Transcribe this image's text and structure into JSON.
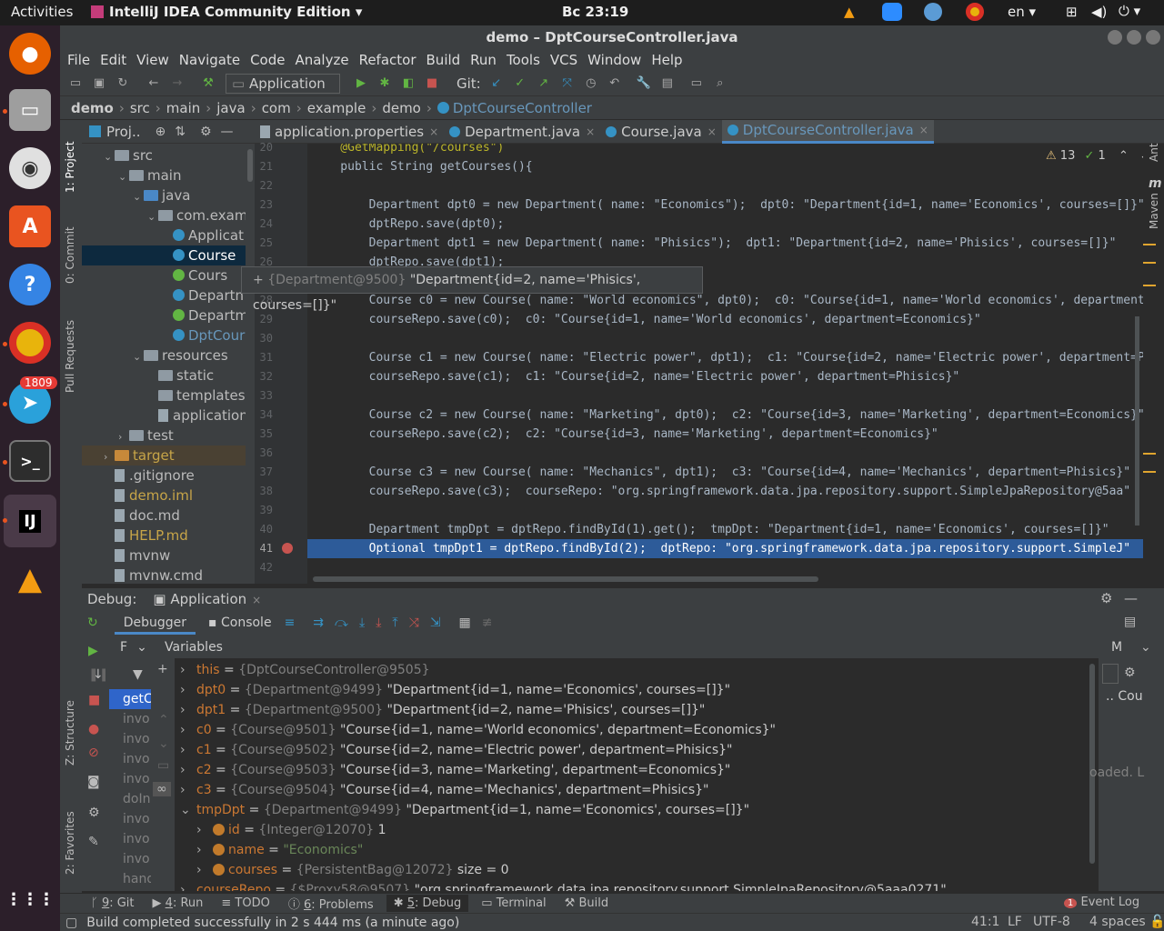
{
  "os": {
    "activities": "Activities",
    "app_menu": "IntelliJ IDEA Community Edition",
    "clock": "Вс 23:19",
    "lang": "en",
    "telegram_badge": "1809"
  },
  "window": {
    "title": "demo – DptCourseController.java"
  },
  "menu": [
    "File",
    "Edit",
    "View",
    "Navigate",
    "Code",
    "Analyze",
    "Refactor",
    "Build",
    "Run",
    "Tools",
    "VCS",
    "Window",
    "Help"
  ],
  "toolbar": {
    "run_config": "Application",
    "git_label": "Git:"
  },
  "breadcrumb": [
    "demo",
    "src",
    "main",
    "java",
    "com",
    "example",
    "demo",
    "DptCourseController"
  ],
  "project": {
    "title": "Proj..",
    "tree": [
      {
        "label": "src",
        "icon": "folder"
      },
      {
        "label": "main",
        "icon": "folder"
      },
      {
        "label": "java",
        "icon": "folder-blue"
      },
      {
        "label": "com.examp",
        "icon": "package"
      },
      {
        "label": "Applicat",
        "icon": "class"
      },
      {
        "label": "Course",
        "icon": "class"
      },
      {
        "label": "Cours",
        "icon": "interface"
      },
      {
        "label": "Departn",
        "icon": "class"
      },
      {
        "label": "Departm",
        "icon": "interface"
      },
      {
        "label": "DptCour",
        "icon": "class"
      },
      {
        "label": "resources",
        "icon": "folder"
      },
      {
        "label": "static",
        "icon": "folder"
      },
      {
        "label": "templates",
        "icon": "folder"
      },
      {
        "label": "application",
        "icon": "file"
      },
      {
        "label": "test",
        "icon": "folder"
      },
      {
        "label": "target",
        "icon": "folder-orange"
      },
      {
        "label": ".gitignore",
        "icon": "file"
      },
      {
        "label": "demo.iml",
        "icon": "file"
      },
      {
        "label": "doc.md",
        "icon": "file"
      },
      {
        "label": "HELP.md",
        "icon": "file"
      },
      {
        "label": "mvnw",
        "icon": "file"
      },
      {
        "label": "mvnw.cmd",
        "icon": "file"
      }
    ]
  },
  "tabs": [
    "application.properties",
    "Department.java",
    "Course.java",
    "DptCourseController.java"
  ],
  "inspections": {
    "warnings": "13",
    "ok": "1"
  },
  "editor": {
    "lines": [
      "20",
      "21",
      "22",
      "23",
      "24",
      "25",
      "26",
      "27",
      "28",
      "29",
      "30",
      "31",
      "32",
      "33",
      "34",
      "35",
      "36",
      "37",
      "38",
      "39",
      "40",
      "41",
      "42"
    ],
    "code": [
      {
        "t": "    @GetMapping(\"/courses\")",
        "c": "ann"
      },
      {
        "t": "    public String getCourses(){",
        "c": "kwline"
      },
      {
        "t": "",
        "c": ""
      },
      {
        "t": "        Department dpt0 = new Department( name: \"Economics\");  dpt0: \"Department{id=1, name='Economics', courses=[]}\"",
        "c": "code"
      },
      {
        "t": "        dptRepo.save(dpt0);",
        "c": "code"
      },
      {
        "t": "        Department dpt1 = new Department( name: \"Phisics\");  dpt1: \"Department{id=2, name='Phisics', courses=[]}\"",
        "c": "code"
      },
      {
        "t": "        dptRepo.save(dpt1);",
        "c": "code"
      },
      {
        "t": "",
        "c": ""
      },
      {
        "t": "        Course c0 = new Course( name: \"World economics\", dpt0);  c0: \"Course{id=1, name='World economics', department=Economics}\"",
        "c": "code"
      },
      {
        "t": "        courseRepo.save(c0);  c0: \"Course{id=1, name='World economics', department=Economics}\"",
        "c": "code"
      },
      {
        "t": "",
        "c": ""
      },
      {
        "t": "        Course c1 = new Course( name: \"Electric power\", dpt1);  c1: \"Course{id=2, name='Electric power', department=Phisics}\"",
        "c": "code"
      },
      {
        "t": "        courseRepo.save(c1);  c1: \"Course{id=2, name='Electric power', department=Phisics}\"",
        "c": "code"
      },
      {
        "t": "",
        "c": ""
      },
      {
        "t": "        Course c2 = new Course( name: \"Marketing\", dpt0);  c2: \"Course{id=3, name='Marketing', department=Economics}\"",
        "c": "code"
      },
      {
        "t": "        courseRepo.save(c2);  c2: \"Course{id=3, name='Marketing', department=Economics}\"",
        "c": "code"
      },
      {
        "t": "",
        "c": ""
      },
      {
        "t": "        Course c3 = new Course( name: \"Mechanics\", dpt1);  c3: \"Course{id=4, name='Mechanics', department=Phisics}\"",
        "c": "code"
      },
      {
        "t": "        courseRepo.save(c3);  courseRepo: \"org.springframework.data.jpa.repository.support.SimpleJpaRepository@5aa\"",
        "c": "code"
      },
      {
        "t": "",
        "c": ""
      },
      {
        "t": "        Department tmpDpt = dptRepo.findById(1).get();  tmpDpt: \"Department{id=1, name='Economics', courses=[]}\"",
        "c": "code"
      },
      {
        "t": "        Optional tmpDpt1 = dptRepo.findById(2);  dptRepo: \"org.springframework.data.jpa.repository.support.SimpleJ\"",
        "c": "cur"
      },
      {
        "t": "",
        "c": ""
      }
    ],
    "tooltip": {
      "type": "{Department@9500}",
      "value": "\"Department{id=2, name='Phisics', courses=[]}\""
    }
  },
  "debug": {
    "label": "Debug:",
    "session": "Application",
    "tabs": {
      "debugger": "Debugger",
      "console": "Console"
    },
    "frames_label": "F",
    "variables_title": "Variables",
    "frames": [
      "getC",
      "invo",
      "invo",
      "invo",
      "invo",
      "doIn",
      "invo",
      "invo",
      "invo",
      "hand"
    ],
    "right_panel": {
      "col": "M",
      "item": "Cou",
      "loaded": "oaded. L"
    },
    "vars": [
      {
        "name": "this",
        "type": "{DptCourseController@9505}",
        "val": "",
        "depth": 0,
        "exp": false,
        "icon": "none"
      },
      {
        "name": "dpt0",
        "type": "{Department@9499}",
        "val": "\"Department{id=1, name='Economics', courses=[]}\"",
        "depth": 0,
        "exp": false,
        "icon": "none"
      },
      {
        "name": "dpt1",
        "type": "{Department@9500}",
        "val": "\"Department{id=2, name='Phisics', courses=[]}\"",
        "depth": 0,
        "exp": false,
        "icon": "none"
      },
      {
        "name": "c0",
        "type": "{Course@9501}",
        "val": "\"Course{id=1, name='World economics', department=Economics}\"",
        "depth": 0,
        "exp": false,
        "icon": "none"
      },
      {
        "name": "c1",
        "type": "{Course@9502}",
        "val": "\"Course{id=2, name='Electric power', department=Phisics}\"",
        "depth": 0,
        "exp": false,
        "icon": "none"
      },
      {
        "name": "c2",
        "type": "{Course@9503}",
        "val": "\"Course{id=3, name='Marketing', department=Economics}\"",
        "depth": 0,
        "exp": false,
        "icon": "none"
      },
      {
        "name": "c3",
        "type": "{Course@9504}",
        "val": "\"Course{id=4, name='Mechanics', department=Phisics}\"",
        "depth": 0,
        "exp": false,
        "icon": "none"
      },
      {
        "name": "tmpDpt",
        "type": "{Department@9499}",
        "val": "\"Department{id=1, name='Economics', courses=[]}\"",
        "depth": 0,
        "exp": true,
        "icon": "none"
      },
      {
        "name": "id",
        "type": "{Integer@12070}",
        "val": "1",
        "depth": 1,
        "exp": false,
        "icon": "field"
      },
      {
        "name": "name",
        "type": "",
        "val": "\"Economics\"",
        "depth": 1,
        "exp": false,
        "icon": "field"
      },
      {
        "name": "courses",
        "type": "{PersistentBag@12072}",
        "val": "size = 0",
        "depth": 1,
        "exp": false,
        "icon": "field"
      },
      {
        "name": "courseRepo",
        "type": "{$Proxy58@9507}",
        "val": "\"org.springframework.data.jpa.repository.support.SimpleJpaRepository@5aaa0271\"",
        "depth": 0,
        "exp": false,
        "icon": "none"
      }
    ]
  },
  "bottom_tabs": [
    {
      "num": "9",
      "label": ": Git"
    },
    {
      "num": "4",
      "label": ": Run"
    },
    {
      "num": "",
      "label": "TODO"
    },
    {
      "num": "6",
      "label": ": Problems"
    },
    {
      "num": "5",
      "label": ": Debug"
    },
    {
      "num": "",
      "label": "Terminal"
    },
    {
      "num": "",
      "label": "Build"
    }
  ],
  "event_log": "Event Log",
  "status": {
    "message": "Build completed successfully in 2 s 444 ms (a minute ago)",
    "position": "41:1",
    "line_sep": "LF",
    "encoding": "UTF-8",
    "indent": "4 spaces"
  },
  "side_labels": {
    "project": "1: Project",
    "commit": "0: Commit",
    "pull": "Pull Requests",
    "structure": "Z: Structure",
    "favorites": "2: Favorites",
    "ant": "Ant",
    "maven": "Maven"
  }
}
